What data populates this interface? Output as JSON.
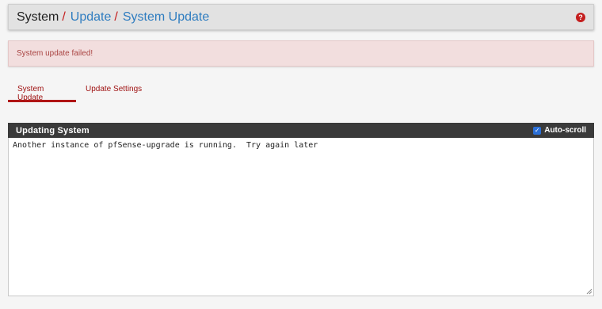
{
  "breadcrumb": {
    "items": [
      "System",
      "Update",
      "System Update"
    ],
    "separator": "/"
  },
  "help_icon": {
    "icon": "help-icon",
    "glyph": "?"
  },
  "alert": {
    "text": "System update failed!"
  },
  "tabs": [
    {
      "label": "System Update",
      "active": true
    },
    {
      "label": "Update Settings",
      "active": false
    }
  ],
  "panel": {
    "title": "Updating System",
    "autoscroll_label": "Auto-scroll",
    "autoscroll_checked": true,
    "output": "Another instance of pfSense-upgrade is running.  Try again later"
  },
  "colors": {
    "accent": "#b01515",
    "link": "#2f7dc0",
    "alert_bg": "#f2dede",
    "panel_head": "#3a3a3a"
  }
}
